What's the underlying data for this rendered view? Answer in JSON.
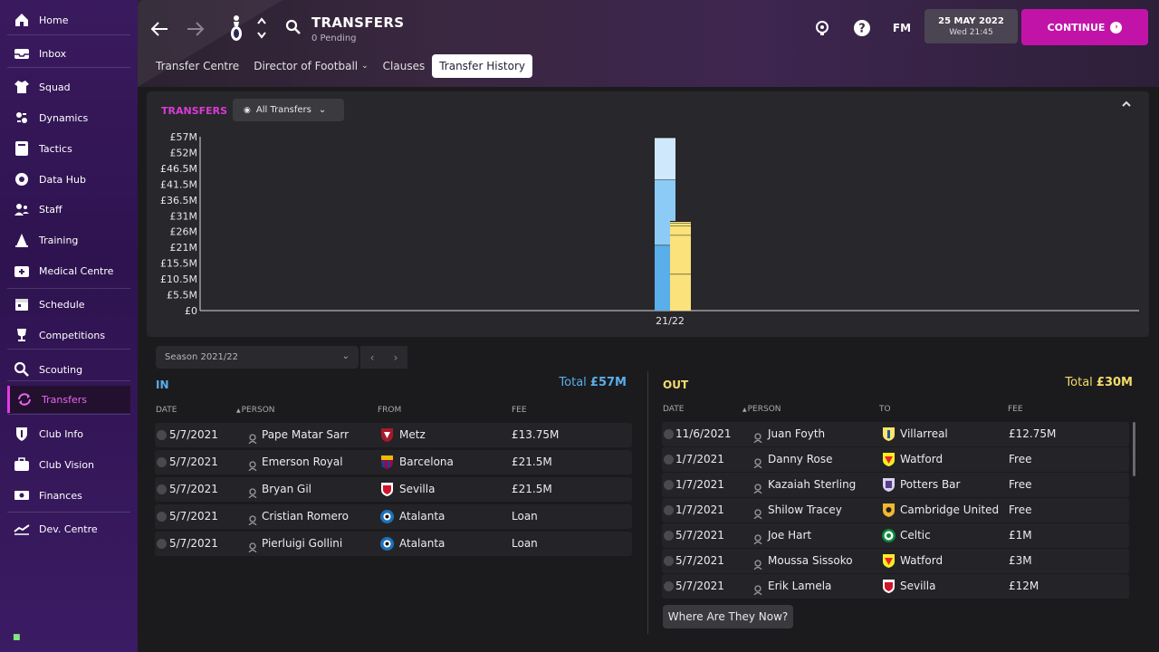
{
  "sidebar": {
    "items": [
      {
        "label": "Home",
        "icon": "home-icon"
      },
      {
        "label": "Inbox",
        "icon": "inbox-icon"
      },
      {
        "label": "Squad",
        "icon": "shirt-icon"
      },
      {
        "label": "Dynamics",
        "icon": "dynamics-icon"
      },
      {
        "label": "Tactics",
        "icon": "tactics-icon"
      },
      {
        "label": "Data Hub",
        "icon": "data-hub-icon"
      },
      {
        "label": "Staff",
        "icon": "staff-icon"
      },
      {
        "label": "Training",
        "icon": "training-icon"
      },
      {
        "label": "Medical Centre",
        "icon": "medical-icon"
      },
      {
        "label": "Schedule",
        "icon": "schedule-icon"
      },
      {
        "label": "Competitions",
        "icon": "trophy-icon"
      },
      {
        "label": "Scouting",
        "icon": "scouting-icon"
      },
      {
        "label": "Transfers",
        "icon": "transfers-icon"
      },
      {
        "label": "Club Info",
        "icon": "shield-icon"
      },
      {
        "label": "Club Vision",
        "icon": "briefcase-icon"
      },
      {
        "label": "Finances",
        "icon": "finances-icon"
      },
      {
        "label": "Dev. Centre",
        "icon": "dev-centre-icon"
      }
    ],
    "active": "Transfers"
  },
  "header": {
    "title": "TRANSFERS",
    "subtitle": "0 Pending",
    "fm_label": "FM",
    "date": "25 MAY 2022",
    "time": "Wed 21:45",
    "continue_label": "CONTINUE",
    "tabs": [
      {
        "label": "Transfer Centre",
        "has_chevron": false,
        "active": false
      },
      {
        "label": "Director of Football",
        "has_chevron": true,
        "active": false
      },
      {
        "label": "Clauses",
        "has_chevron": false,
        "active": false
      },
      {
        "label": "Transfer History",
        "has_chevron": false,
        "active": true
      }
    ]
  },
  "chart_panel": {
    "title": "TRANSFERS",
    "filter_label": "All Transfers"
  },
  "chart_data": {
    "type": "bar",
    "stacked": true,
    "categories": [
      "21/22"
    ],
    "ylim": [
      0,
      57
    ],
    "yticks": [
      "£0",
      "£5.5M",
      "£10.5M",
      "£15.5M",
      "£21M",
      "£26M",
      "£31M",
      "£36.5M",
      "£41.5M",
      "£46.5M",
      "£52M",
      "£57M"
    ],
    "series": [
      {
        "group": "in",
        "segments": [
          21.5,
          21.5,
          13.75
        ],
        "colors": [
          "#5aaeea",
          "#8ccbf5",
          "#cfe8fb"
        ]
      },
      {
        "group": "out",
        "segments": [
          12,
          12.75,
          3,
          1,
          0.5
        ],
        "colors": [
          "#fbe27a",
          "#fbe27a",
          "#fbe27a",
          "#fbe27a",
          "#fbe27a"
        ]
      }
    ],
    "grid": false
  },
  "season": {
    "label": "Season 2021/22"
  },
  "in_table": {
    "title": "IN",
    "total_label": "Total",
    "total_value": "£57M",
    "columns": [
      "DATE",
      "PERSON",
      "FROM",
      "FEE"
    ],
    "rows": [
      {
        "date": "5/7/2021",
        "person": "Pape Matar Sarr",
        "club": "Metz",
        "fee": "£13.75M",
        "crest": "metz"
      },
      {
        "date": "5/7/2021",
        "person": "Emerson Royal",
        "club": "Barcelona",
        "fee": "£21.5M",
        "crest": "barcelona"
      },
      {
        "date": "5/7/2021",
        "person": "Bryan Gil",
        "club": "Sevilla",
        "fee": "£21.5M",
        "crest": "sevilla"
      },
      {
        "date": "5/7/2021",
        "person": "Cristian Romero",
        "club": "Atalanta",
        "fee": "Loan",
        "crest": "atalanta"
      },
      {
        "date": "5/7/2021",
        "person": "Pierluigi Gollini",
        "club": "Atalanta",
        "fee": "Loan",
        "crest": "atalanta"
      }
    ]
  },
  "out_table": {
    "title": "OUT",
    "total_label": "Total",
    "total_value": "£30M",
    "columns": [
      "DATE",
      "PERSON",
      "TO",
      "FEE"
    ],
    "rows": [
      {
        "date": "11/6/2021",
        "person": "Juan Foyth",
        "club": "Villarreal",
        "fee": "£12.75M",
        "crest": "villarreal"
      },
      {
        "date": "1/7/2021",
        "person": "Danny Rose",
        "club": "Watford",
        "fee": "Free",
        "crest": "watford"
      },
      {
        "date": "1/7/2021",
        "person": "Kazaiah Sterling",
        "club": "Potters Bar",
        "fee": "Free",
        "crest": "potters"
      },
      {
        "date": "1/7/2021",
        "person": "Shilow Tracey",
        "club": "Cambridge United",
        "fee": "Free",
        "crest": "cambridge"
      },
      {
        "date": "5/7/2021",
        "person": "Joe Hart",
        "club": "Celtic",
        "fee": "£1M",
        "crest": "celtic"
      },
      {
        "date": "5/7/2021",
        "person": "Moussa Sissoko",
        "club": "Watford",
        "fee": "£3M",
        "crest": "watford"
      },
      {
        "date": "5/7/2021",
        "person": "Erik Lamela",
        "club": "Sevilla",
        "fee": "£12M",
        "crest": "sevilla"
      }
    ],
    "where_button": "Where Are They Now?"
  },
  "colors": {
    "accent": "#c213a9",
    "in": "#5aaeea",
    "out": "#fbe27a",
    "chart_title": "#d93bd6"
  }
}
